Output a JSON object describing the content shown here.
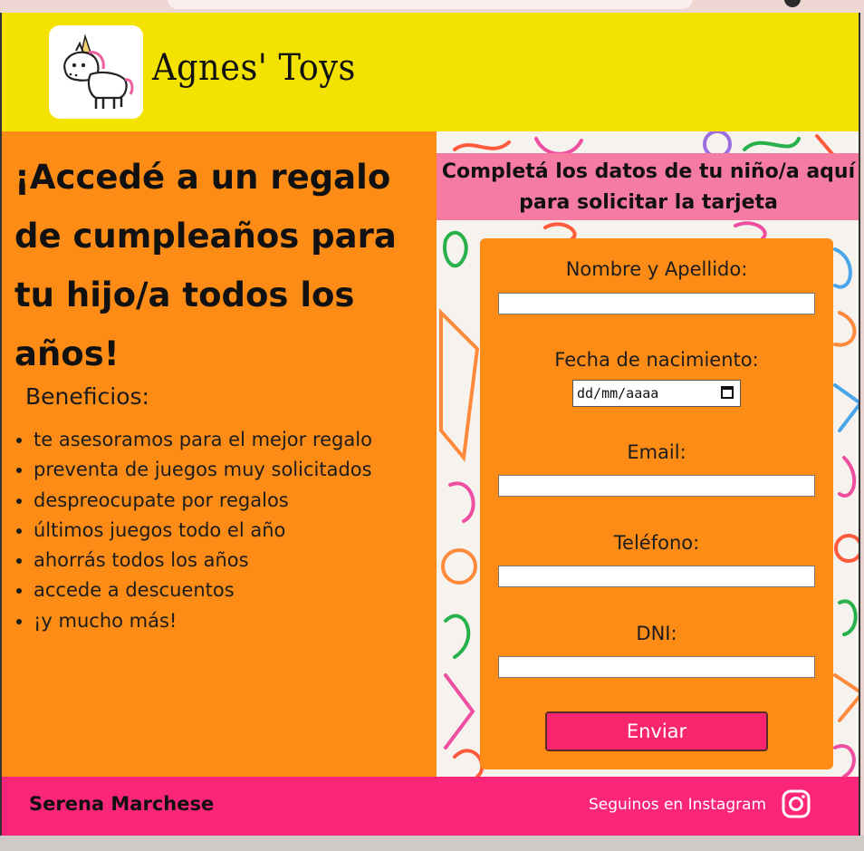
{
  "brand": {
    "name": "Agnes' Toys",
    "logo_icon": "unicorn-icon"
  },
  "hero": {
    "title": "¡Accedé a un regalo de cumpleaños para tu hijo/a todos los años!",
    "benefits_title": "Beneficios:",
    "benefits": [
      "te asesoramos para el mejor regalo",
      "preventa de juegos muy solicitados",
      "despreocupate por regalos",
      "últimos juegos todo el año",
      "ahorrás todos los años",
      "accede a descuentos",
      "¡y mucho más!"
    ]
  },
  "form": {
    "banner": "Completá los datos de tu niño/a aquí para solicitar la tarjeta",
    "fields": {
      "name_label": "Nombre y Apellido:",
      "birth_label": "Fecha de nacimiento:",
      "birth_placeholder": "dd/mm/aaaa",
      "email_label": "Email:",
      "phone_label": "Teléfono:",
      "dni_label": "DNI:"
    },
    "submit": "Enviar"
  },
  "footer": {
    "author": "Serena Marchese",
    "instagram_text": "Seguinos en Instagram",
    "instagram_icon": "instagram-icon"
  },
  "colors": {
    "header_bg": "#f4e300",
    "panel_orange": "#fd8c17",
    "banner_pink": "#f57ba3",
    "accent_pink": "#fb267a",
    "button_pink": "#f9266f"
  }
}
